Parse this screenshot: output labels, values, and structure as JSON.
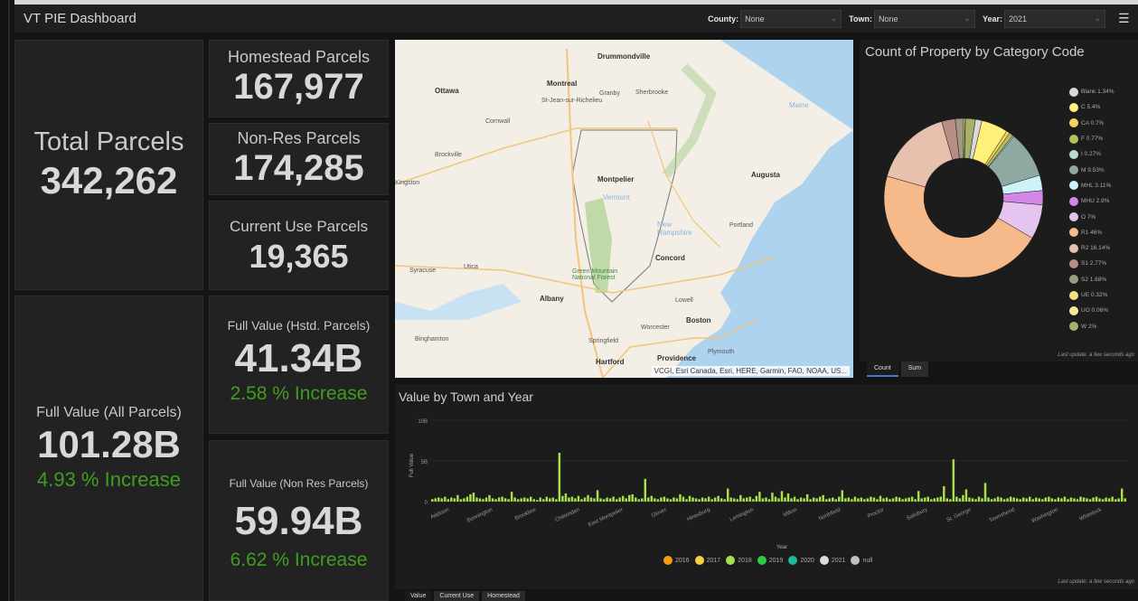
{
  "header": {
    "title": "VT PIE Dashboard",
    "filters": [
      {
        "label": "County:",
        "value": "None"
      },
      {
        "label": "Town:",
        "value": "None"
      },
      {
        "label": "Year:",
        "value": "2021"
      }
    ]
  },
  "cards": {
    "total_parcels": {
      "label": "Total Parcels",
      "value": "342,262"
    },
    "homestead": {
      "label": "Homestead Parcels",
      "value": "167,977"
    },
    "nonres": {
      "label": "Non-Res Parcels",
      "value": "174,285"
    },
    "current_use": {
      "label": "Current Use Parcels",
      "value": "19,365"
    },
    "full_value_all": {
      "label": "Full Value (All Parcels)",
      "value": "101.28B",
      "change": "4.93 % Increase"
    },
    "full_value_hstd": {
      "label": "Full Value (Hstd. Parcels)",
      "value": "41.34B",
      "change": "2.58 % Increase"
    },
    "full_value_nonres": {
      "label": "Full Value (Non Res Parcels)",
      "value": "59.94B",
      "change": "6.62 % Increase"
    }
  },
  "map": {
    "attribution": "VCGI, Esri Canada, Esri, HERE, Garmin, FAO, NOAA, US...",
    "labels": [
      "Drummondville",
      "Ottawa",
      "Montreal",
      "Granby",
      "Sherbrooke",
      "St-Jean-sur-Richelieu",
      "Cornwall",
      "Brockville",
      "Kingston",
      "Montpelier",
      "Vermont",
      "Augusta",
      "Maine",
      "New Hampshire",
      "Portland",
      "Concord",
      "Syracuse",
      "Utica",
      "Albany",
      "Green Mountain National Forest",
      "Lowell",
      "Boston",
      "Worcester",
      "Binghamton",
      "Springfield",
      "Hartford",
      "Providence",
      "Plymouth"
    ]
  },
  "pie": {
    "title": "Count of Property by Category Code",
    "update_text": "Last update: a few seconds ago",
    "tabs": [
      "Count",
      "Sum"
    ],
    "active_tab": "Count"
  },
  "bar": {
    "title": "Value by Town and Year",
    "update_text": "Last update: a few seconds ago",
    "tabs": [
      "Value",
      "Current Use",
      "Homestead"
    ],
    "active_tab": "Value"
  },
  "chart_data": [
    {
      "type": "pie",
      "title": "Count of Property by Category Code",
      "categories": [
        {
          "name": "Blank 1.34%",
          "value": 1.34,
          "color": "#d9d9d9"
        },
        {
          "name": "C 5.4%",
          "value": 5.4,
          "color": "#fff07a"
        },
        {
          "name": "CA 0.7%",
          "value": 0.7,
          "color": "#f4d35e"
        },
        {
          "name": "F 0.77%",
          "value": 0.77,
          "color": "#b7c25a"
        },
        {
          "name": "I 0.27%",
          "value": 0.27,
          "color": "#b8dcd0"
        },
        {
          "name": "M 9.53%",
          "value": 9.53,
          "color": "#8fa9a2"
        },
        {
          "name": "MHL 3.11%",
          "value": 3.11,
          "color": "#cdf2f7"
        },
        {
          "name": "MHU 2.9%",
          "value": 2.9,
          "color": "#d287e6"
        },
        {
          "name": "O 7%",
          "value": 7,
          "color": "#e5c5f0"
        },
        {
          "name": "R1 46%",
          "value": 46,
          "color": "#f6b98a"
        },
        {
          "name": "R2 16.14%",
          "value": 16.14,
          "color": "#e8c1ae"
        },
        {
          "name": "S1 2.77%",
          "value": 2.77,
          "color": "#b98c84"
        },
        {
          "name": "S2 1.68%",
          "value": 1.68,
          "color": "#9e9a82"
        },
        {
          "name": "UE 0.32%",
          "value": 0.32,
          "color": "#f2e07a"
        },
        {
          "name": "UO 0.06%",
          "value": 0.06,
          "color": "#f7e89a"
        },
        {
          "name": "W 2%",
          "value": 2,
          "color": "#a6b06a"
        }
      ]
    },
    {
      "type": "bar",
      "title": "Value by Town and Year",
      "xlabel": "Year",
      "ylabel": "Full Value",
      "ylim": [
        0,
        10
      ],
      "yticks": [
        "0",
        "5B",
        "10B"
      ],
      "x_tick_labels": [
        "Addison",
        "Bennington",
        "Brookline",
        "Chittenden",
        "East Montpelier",
        "Glover",
        "Hinesburg",
        "Lemington",
        "Milton",
        "Northfield",
        "Proctor",
        "Salisbury",
        "St. George",
        "Townshend",
        "Washington",
        "Whitelock"
      ],
      "series": [
        {
          "name": "2016",
          "color": "#f39c12"
        },
        {
          "name": "2017",
          "color": "#f4d03f"
        },
        {
          "name": "2018",
          "color": "#a8e04a"
        },
        {
          "name": "2019",
          "color": "#2ecc40"
        },
        {
          "name": "2020",
          "color": "#1abc9c"
        },
        {
          "name": "2021",
          "color": "#dcdcdc"
        },
        {
          "name": "null",
          "color": "#c0c0c0"
        }
      ],
      "values": [
        0.3,
        0.4,
        0.5,
        0.4,
        0.6,
        0.3,
        0.5,
        0.4,
        0.8,
        0.3,
        0.4,
        0.6,
        0.9,
        1.1,
        0.5,
        0.4,
        0.3,
        0.5,
        0.8,
        0.4,
        0.3,
        0.5,
        0.6,
        0.4,
        0.3,
        1.2,
        0.5,
        0.3,
        0.4,
        0.5,
        0.4,
        0.6,
        0.3,
        0.2,
        0.5,
        0.3,
        0.6,
        0.4,
        0.5,
        0.3,
        6.0,
        0.7,
        1.0,
        0.5,
        0.6,
        0.4,
        0.7,
        0.3,
        0.5,
        0.8,
        0.5,
        0.4,
        1.4,
        0.4,
        0.3,
        0.5,
        0.4,
        0.6,
        0.3,
        0.5,
        0.7,
        0.4,
        0.8,
        0.9,
        0.5,
        0.3,
        0.4,
        2.8,
        0.5,
        0.7,
        0.4,
        0.3,
        0.5,
        0.6,
        0.4,
        0.3,
        0.5,
        0.4,
        0.9,
        0.6,
        0.3,
        0.7,
        0.5,
        0.4,
        0.3,
        0.5,
        0.4,
        0.6,
        0.3,
        0.5,
        0.7,
        0.4,
        0.3,
        1.6,
        0.5,
        0.4,
        0.3,
        0.8,
        0.4,
        0.5,
        0.6,
        0.3,
        0.7,
        1.2,
        0.4,
        0.5,
        0.3,
        1.1,
        0.6,
        0.4,
        1.3,
        0.5,
        1.0,
        0.4,
        0.6,
        0.3,
        0.5,
        0.4,
        0.9,
        0.3,
        0.5,
        0.4,
        0.6,
        0.8,
        0.3,
        0.4,
        0.5,
        0.3,
        0.6,
        1.4,
        0.4,
        0.5,
        0.3,
        0.6,
        0.4,
        0.5,
        0.3,
        0.4,
        0.6,
        0.5,
        0.3,
        0.7,
        0.4,
        0.5,
        0.3,
        0.4,
        0.6,
        0.5,
        0.3,
        0.4,
        0.5,
        0.6,
        0.3,
        1.3,
        0.4,
        0.5,
        0.6,
        0.3,
        0.4,
        0.5,
        0.6,
        1.9,
        0.4,
        0.3,
        5.2,
        0.6,
        0.4,
        0.8,
        1.5,
        0.5,
        0.4,
        0.3,
        0.6,
        0.4,
        2.3,
        0.5,
        0.3,
        0.4,
        0.6,
        0.5,
        0.3,
        0.4,
        0.6,
        0.5,
        0.4,
        0.3,
        0.5,
        0.4,
        0.6,
        0.3,
        0.5,
        0.4,
        0.3,
        0.5,
        0.6,
        0.4,
        0.3,
        0.5,
        0.4,
        0.6,
        0.3,
        0.5,
        0.4,
        0.3,
        0.6,
        0.5,
        0.4,
        0.3,
        0.5,
        0.6,
        0.4,
        0.3,
        0.5,
        0.4,
        0.6,
        0.3,
        0.4,
        1.6,
        0.4
      ]
    }
  ]
}
